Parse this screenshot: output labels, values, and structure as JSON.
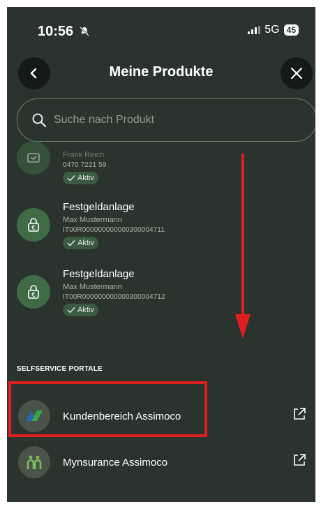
{
  "status": {
    "time": "10:56",
    "network": "5G",
    "battery": "45"
  },
  "header": {
    "title": "Meine Produkte"
  },
  "search": {
    "placeholder": "Suche nach Produkt"
  },
  "products": [
    {
      "name": "",
      "owner": "Frank Reich",
      "iban": "0470 7221 59",
      "status": "Aktiv",
      "icon": "device-icon"
    },
    {
      "name": "Festgeldanlage",
      "owner": "Max Mustermann",
      "iban": "IT00R000000000000300004711",
      "status": "Aktiv",
      "icon": "euro-lock-icon"
    },
    {
      "name": "Festgeldanlage",
      "owner": "Max Mustermann",
      "iban": "IT00R000000000000300004712",
      "status": "Aktiv",
      "icon": "euro-lock-icon"
    }
  ],
  "portals": {
    "section_title": "SELFSERVICE PORTALE",
    "items": [
      {
        "label": "Kundenbereich Assimoco",
        "icon": "assimoco-logo-icon"
      },
      {
        "label": "Mynsurance Assimoco",
        "icon": "mynsurance-logo-icon"
      }
    ]
  },
  "annotation_color": "#e01e1e"
}
